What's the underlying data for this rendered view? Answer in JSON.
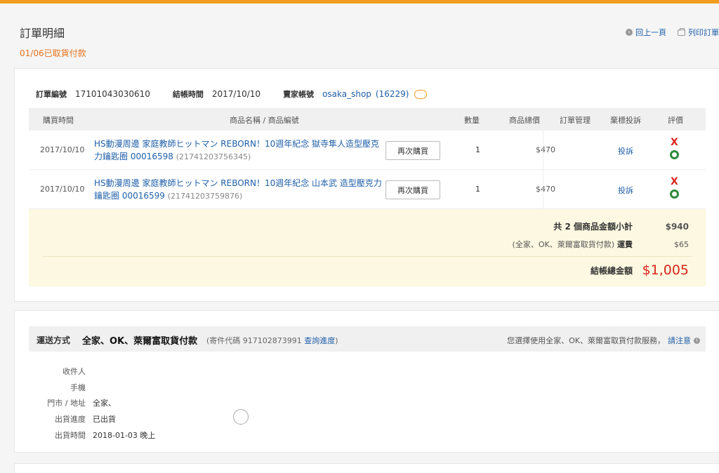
{
  "header": {
    "title": "訂單明細",
    "status": "01/06已取貨付款",
    "back_label": "回上一頁",
    "print_label": "列印訂單"
  },
  "order": {
    "number_label": "訂單編號",
    "number": "17101043030610",
    "checkout_label": "結帳時間",
    "checkout_time": "2017/10/10",
    "seller_label": "賣家帳號",
    "seller": "osaka_shop",
    "seller_count": "(16229)"
  },
  "table": {
    "headers": {
      "time": "購買時間",
      "name": "商品名稱 / 商品編號",
      "qty": "數量",
      "total": "商品總價",
      "mgmt": "訂單管理",
      "complain": "棄標投訴",
      "rating": "評價"
    },
    "rows": [
      {
        "date": "2017/10/10",
        "name": "HS動漫周邊 家庭教師ヒットマン REBORN！10週年紀念 獄寺隼人造型壓克力鑰匙圈 00016598",
        "code": "(21741203756345)",
        "rebuy": "再次購買",
        "qty": "1",
        "total": "$470",
        "complain": "投訴"
      },
      {
        "date": "2017/10/10",
        "name": "HS動漫周邊 家庭教師ヒットマン REBORN！10週年紀念 山本武 造型壓克力鑰匙圈 00016599",
        "code": "(21741203759876)",
        "rebuy": "再次購買",
        "qty": "1",
        "total": "$470",
        "complain": "投訴"
      }
    ]
  },
  "summary": {
    "subtotal_label": "共 2 個商品金額小計",
    "subtotal": "$940",
    "shipping_note": "(全家、OK、萊爾富取貨付款)",
    "shipping_label": "運費",
    "shipping": "$65",
    "total_label": "結帳總金額",
    "total": "$1,005"
  },
  "shipping": {
    "title": "運送方式",
    "method": "全家、OK、萊爾富取貨付款",
    "code_text": "(寄件代碼 917102873991",
    "track_label": "查詢進度",
    "code_close": ")",
    "notice": "您選擇使用全家、OK、萊爾富取貨付款服務，",
    "attention": "請注意",
    "fields": [
      {
        "k": "收件人",
        "v": ""
      },
      {
        "k": "手機",
        "v": ""
      },
      {
        "k": "門市 / 地址",
        "v": "全家、"
      },
      {
        "k": "出貨進度",
        "v": "已出貨"
      },
      {
        "k": "出貨時間",
        "v": "2018-01-03 晚上"
      }
    ]
  },
  "colors": {
    "accent": "#f29c1f",
    "link": "#1f5fa8",
    "price_red": "#d9261c",
    "status_orange": "#e8721c",
    "summary_bg": "#fdf8e1"
  }
}
